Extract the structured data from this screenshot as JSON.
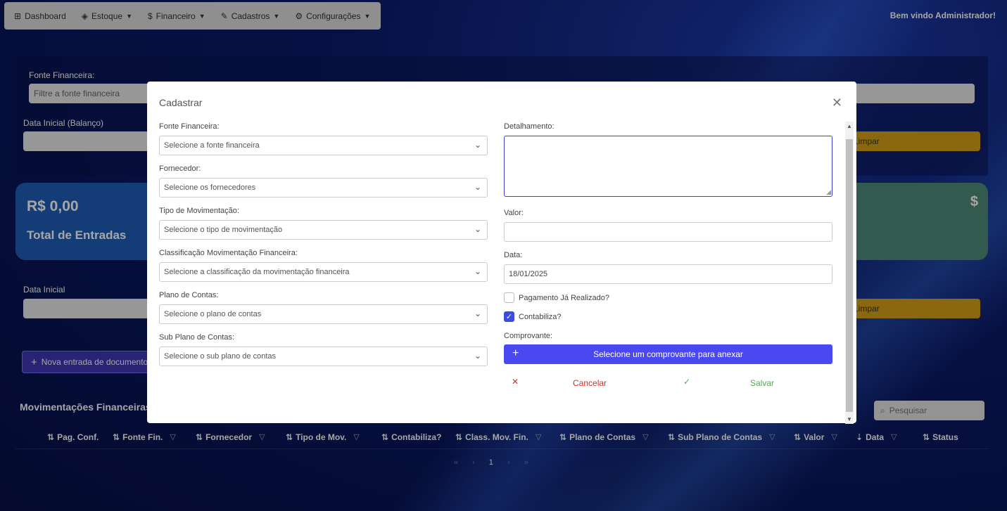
{
  "nav": {
    "items": [
      {
        "icon": "grid-icon",
        "glyph": "⊞",
        "label": "Dashboard",
        "dropdown": false
      },
      {
        "icon": "layers-icon",
        "glyph": "◈",
        "label": "Estoque",
        "dropdown": true
      },
      {
        "icon": "dollar-icon",
        "glyph": "$",
        "label": "Financeiro",
        "dropdown": true
      },
      {
        "icon": "form-icon",
        "glyph": "✎",
        "label": "Cadastros",
        "dropdown": true
      },
      {
        "icon": "gear-icon",
        "glyph": "⚙",
        "label": "Configurações",
        "dropdown": true
      }
    ],
    "welcome": "Bem vindo Administrador!"
  },
  "background": {
    "fonte_label": "Fonte Financeira:",
    "fonte_placeholder": "Filtre a fonte financeira",
    "data_inicial_balanco_label": "Data Inicial (Balanço)",
    "limpar_label": "Limpar",
    "card_value": "R$ 0,00",
    "card_title": "Total de Entradas",
    "card_green_icon": "$",
    "data_inicial_label": "Data Inicial",
    "new_button_label": "Nova entrada de documento",
    "section_title": "Movimentações Financeiras",
    "search_placeholder": "Pesquisar",
    "columns": [
      "Pag. Conf.",
      "Fonte Fin.",
      "Fornecedor",
      "Tipo de Mov.",
      "Contabiliza?",
      "Class. Mov. Fin.",
      "Plano de Contas",
      "Sub Plano de Contas",
      "Valor",
      "Data",
      "Status"
    ],
    "pager": {
      "first": "«",
      "prev": "‹",
      "current": "1",
      "next": "›",
      "last": "»"
    }
  },
  "modal": {
    "title": "Cadastrar",
    "fields_left": [
      {
        "label": "Fonte Financeira:",
        "placeholder": "Selecione a fonte financeira"
      },
      {
        "label": "Fornecedor:",
        "placeholder": "Selecione os fornecedores"
      },
      {
        "label": "Tipo de Movimentação:",
        "placeholder": "Selecione o tipo de movimentação"
      },
      {
        "label": "Classificação Movimentação Financeira:",
        "placeholder": "Selecione a classificação da movimentação financeira"
      },
      {
        "label": "Plano de Contas:",
        "placeholder": "Selecione o plano de contas"
      },
      {
        "label": "Sub Plano de Contas:",
        "placeholder": "Selecione o sub plano de contas"
      }
    ],
    "detalhamento_label": "Detalhamento:",
    "valor_label": "Valor:",
    "valor_value": "",
    "data_label": "Data:",
    "data_value": "18/01/2025",
    "pagamento_label": "Pagamento Já Realizado?",
    "pagamento_checked": false,
    "contabiliza_label": "Contabiliza?",
    "contabiliza_checked": true,
    "comprovante_label": "Comprovante:",
    "attach_label": "Selecione um comprovante para anexar",
    "cancel_label": "Cancelar",
    "save_label": "Salvar",
    "colors": {
      "accent": "#4a48f0",
      "cancel": "#d32f2f",
      "save": "#4caf50",
      "limpar": "#d4a017"
    }
  }
}
